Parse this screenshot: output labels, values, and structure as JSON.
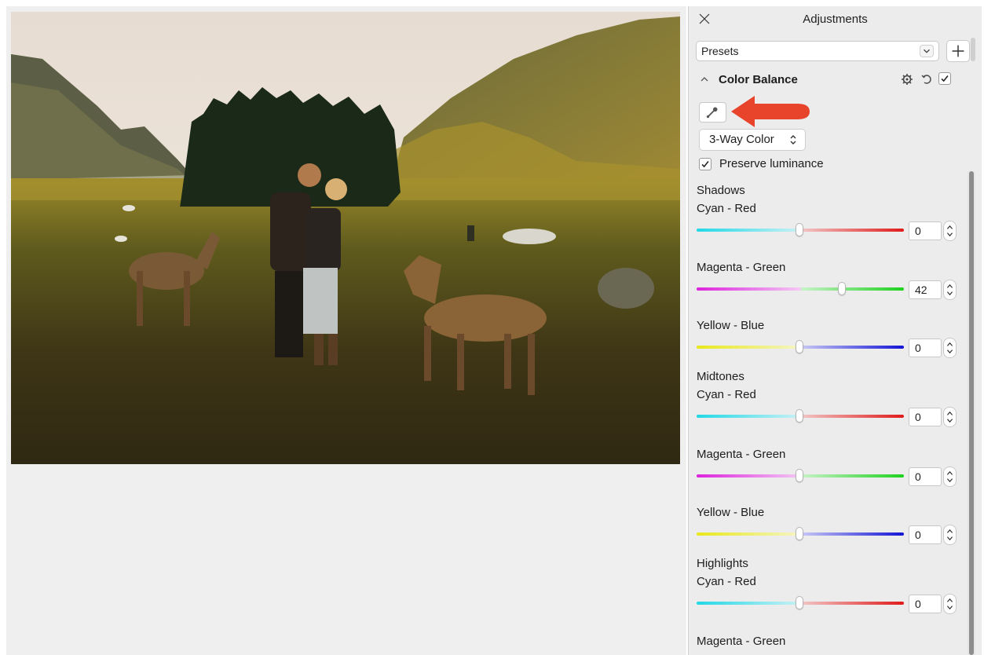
{
  "panel": {
    "title": "Adjustments",
    "presets": "Presets",
    "section_title": "Color Balance",
    "mode": "3-Way Color",
    "preserve_luminance": "Preserve luminance",
    "preserve_luminance_checked": true,
    "section_enabled": true
  },
  "photo": {
    "description_visible": false
  },
  "groups": [
    {
      "label": "Shadows",
      "sliders": [
        {
          "label": "Cyan - Red",
          "value": "0"
        },
        {
          "label": "Magenta - Green",
          "value": "42"
        },
        {
          "label": "Yellow - Blue",
          "value": "0"
        }
      ]
    },
    {
      "label": "Midtones",
      "sliders": [
        {
          "label": "Cyan - Red",
          "value": "0"
        },
        {
          "label": "Magenta - Green",
          "value": "0"
        },
        {
          "label": "Yellow - Blue",
          "value": "0"
        }
      ]
    },
    {
      "label": "Highlights",
      "sliders": [
        {
          "label": "Cyan - Red",
          "value": "0"
        },
        {
          "label": "Magenta - Green",
          "value": ""
        }
      ]
    }
  ],
  "colors": {
    "callout_arrow": "#e8432b",
    "panel_bg": "#ececec",
    "canvas_bg": "#efefef"
  },
  "icons": {
    "close": "close-icon",
    "dropper": "eyedropper-icon",
    "gear": "gear-icon",
    "reset": "reset-icon",
    "collapse": "chevron-up-icon",
    "add": "plus-icon"
  }
}
